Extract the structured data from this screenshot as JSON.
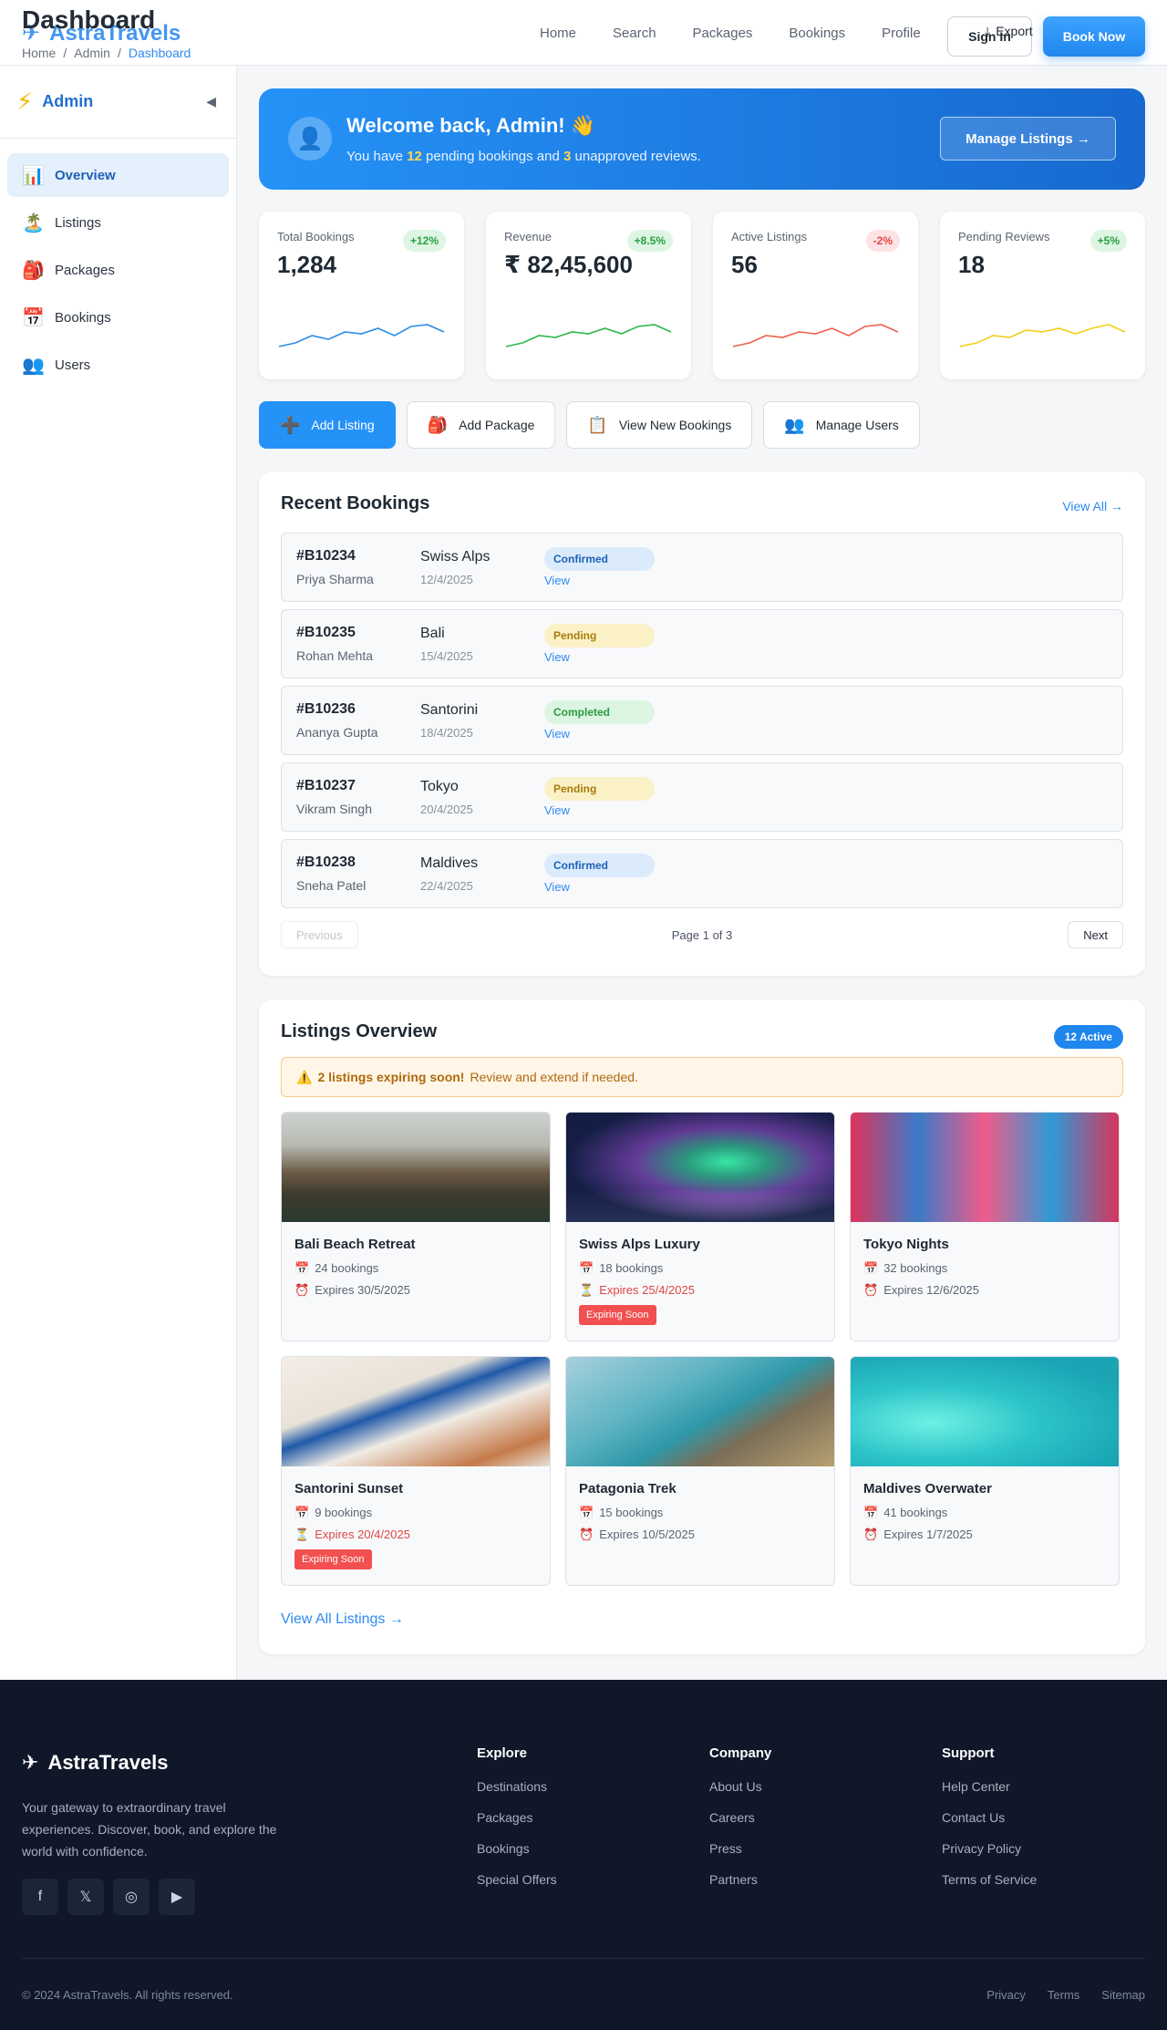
{
  "header": {
    "page_title": "Dashboard",
    "brand": "AstraTravels",
    "breadcrumb": [
      "Home",
      "/",
      "Admin",
      "/",
      "Dashboard"
    ],
    "nav": [
      "Home",
      "Search",
      "Packages",
      "Bookings",
      "Profile"
    ],
    "signin_label": "Sign In",
    "export_label": "Export",
    "book_label": "Book Now"
  },
  "sidebar": {
    "title": "Admin",
    "collapse_glyph": "◀",
    "items": [
      {
        "label": "Overview",
        "icon": "📊",
        "icon_name": "chart-icon",
        "active": true
      },
      {
        "label": "Listings",
        "icon": "🏝️",
        "icon_name": "island-icon",
        "active": false
      },
      {
        "label": "Packages",
        "icon": "🎒",
        "icon_name": "backpack-icon",
        "active": false
      },
      {
        "label": "Bookings",
        "icon": "📅",
        "icon_name": "calendar-icon",
        "active": false
      },
      {
        "label": "Users",
        "icon": "👥",
        "icon_name": "users-icon",
        "active": false
      }
    ]
  },
  "welcome": {
    "title": "Welcome back, Admin! 👋",
    "text_prefix": "You have",
    "pending_count": "12",
    "text_middle": "pending bookings and",
    "review_count": "3",
    "text_suffix": "unapproved reviews.",
    "button_label": "Manage Listings →"
  },
  "stats": [
    {
      "label": "Total Bookings",
      "value": "1,284",
      "delta": "+12%",
      "trend": "up",
      "color": "#2a8de8",
      "spark": [
        2,
        3,
        5,
        4,
        6,
        5.5,
        7,
        5,
        7.5,
        8,
        6
      ]
    },
    {
      "label": "Revenue",
      "value": "₹ 82,45,600",
      "delta": "+8.5%",
      "trend": "up",
      "color": "#2db84d",
      "spark": [
        2,
        3,
        5,
        4.5,
        6,
        5.5,
        7,
        5.5,
        7.5,
        8,
        6
      ]
    },
    {
      "label": "Active Listings",
      "value": "56",
      "delta": "-2%",
      "trend": "down",
      "color": "#f0624d",
      "spark": [
        2,
        3,
        5,
        4.5,
        6,
        5.5,
        7,
        5,
        7.5,
        8,
        6
      ]
    },
    {
      "label": "Pending Reviews",
      "value": "18",
      "delta": "+5%",
      "trend": "up",
      "color": "#f2cf19",
      "spark": [
        2,
        3,
        5,
        4.5,
        6.5,
        6,
        7,
        5.5,
        7,
        8,
        6
      ]
    }
  ],
  "actions": [
    {
      "label": "Add Listing",
      "icon": "➕",
      "icon_name": "plus-icon",
      "primary": true
    },
    {
      "label": "Add Package",
      "icon": "🎒",
      "icon_name": "backpack-icon",
      "primary": false
    },
    {
      "label": "View New Bookings",
      "icon": "📋",
      "icon_name": "clipboard-icon",
      "primary": false
    },
    {
      "label": "Manage Users",
      "icon": "👥",
      "icon_name": "users-icon",
      "primary": false
    }
  ],
  "bookings": {
    "title": "Recent Bookings",
    "view_all": "View All →",
    "rows": [
      {
        "id": "#B10234",
        "name": "Priya Sharma",
        "dest": "Swiss Alps",
        "date": "12/4/2025",
        "status": "Confirmed",
        "status_key": "confirmed",
        "view": "View"
      },
      {
        "id": "#B10235",
        "name": "Rohan Mehta",
        "dest": "Bali",
        "date": "15/4/2025",
        "status": "Pending",
        "status_key": "pending",
        "view": "View"
      },
      {
        "id": "#B10236",
        "name": "Ananya Gupta",
        "dest": "Santorini",
        "date": "18/4/2025",
        "status": "Completed",
        "status_key": "completed",
        "view": "View"
      },
      {
        "id": "#B10237",
        "name": "Vikram Singh",
        "dest": "Tokyo",
        "date": "20/4/2025",
        "status": "Pending",
        "status_key": "pending",
        "view": "View"
      },
      {
        "id": "#B10238",
        "name": "Sneha Patel",
        "dest": "Maldives",
        "date": "22/4/2025",
        "status": "Confirmed",
        "status_key": "confirmed",
        "view": "View"
      }
    ],
    "prev_label": "Previous",
    "page_text": "Page 1 of 3",
    "next_label": "Next"
  },
  "listings": {
    "title": "Listings Overview",
    "badge": "12 Active",
    "warn_icon": "⚠️",
    "warn_bold": "2 listings expiring soon!",
    "warn_text": "Review and extend if needed.",
    "items": [
      {
        "name": "Bali Beach Retreat",
        "bookings": "24 bookings",
        "expires": "Expires 30/5/2025",
        "soon": false,
        "img": "bali"
      },
      {
        "name": "Swiss Alps Luxury",
        "bookings": "18 bookings",
        "expires": "Expires 25/4/2025",
        "soon": true,
        "img": "aurora"
      },
      {
        "name": "Tokyo Nights",
        "bookings": "32 bookings",
        "expires": "Expires 12/6/2025",
        "soon": false,
        "img": "tokyo"
      },
      {
        "name": "Santorini Sunset",
        "bookings": "9 bookings",
        "expires": "Expires 20/4/2025",
        "soon": true,
        "img": "santorini"
      },
      {
        "name": "Patagonia Trek",
        "bookings": "15 bookings",
        "expires": "Expires 10/5/2025",
        "soon": false,
        "img": "coast"
      },
      {
        "name": "Maldives Overwater",
        "bookings": "41 bookings",
        "expires": "Expires 1/7/2025",
        "soon": false,
        "img": "maldives"
      }
    ],
    "soon_badge": "Expiring Soon",
    "bookings_icon": "📅",
    "clock_icon": "⏰",
    "hourglass_icon": "⏳",
    "view_all": "View All Listings →"
  },
  "footer": {
    "brand": "AstraTravels",
    "desc": "Your gateway to extraordinary travel experiences. Discover, book, and explore the world with confidence.",
    "social": [
      {
        "glyph": "f",
        "name": "facebook-icon"
      },
      {
        "glyph": "𝕏",
        "name": "x-icon"
      },
      {
        "glyph": "◎",
        "name": "instagram-icon"
      },
      {
        "glyph": "▶",
        "name": "youtube-icon"
      }
    ],
    "columns": [
      {
        "title": "Explore",
        "links": [
          "Destinations",
          "Packages",
          "Bookings",
          "Special Offers"
        ]
      },
      {
        "title": "Company",
        "links": [
          "About Us",
          "Careers",
          "Press",
          "Partners"
        ]
      },
      {
        "title": "Support",
        "links": [
          "Help Center",
          "Contact Us",
          "Privacy Policy",
          "Terms of Service"
        ]
      }
    ],
    "copyright": "© 2024 AstraTravels. All rights reserved.",
    "bottom_links": [
      "Privacy",
      "Terms",
      "Sitemap"
    ]
  }
}
